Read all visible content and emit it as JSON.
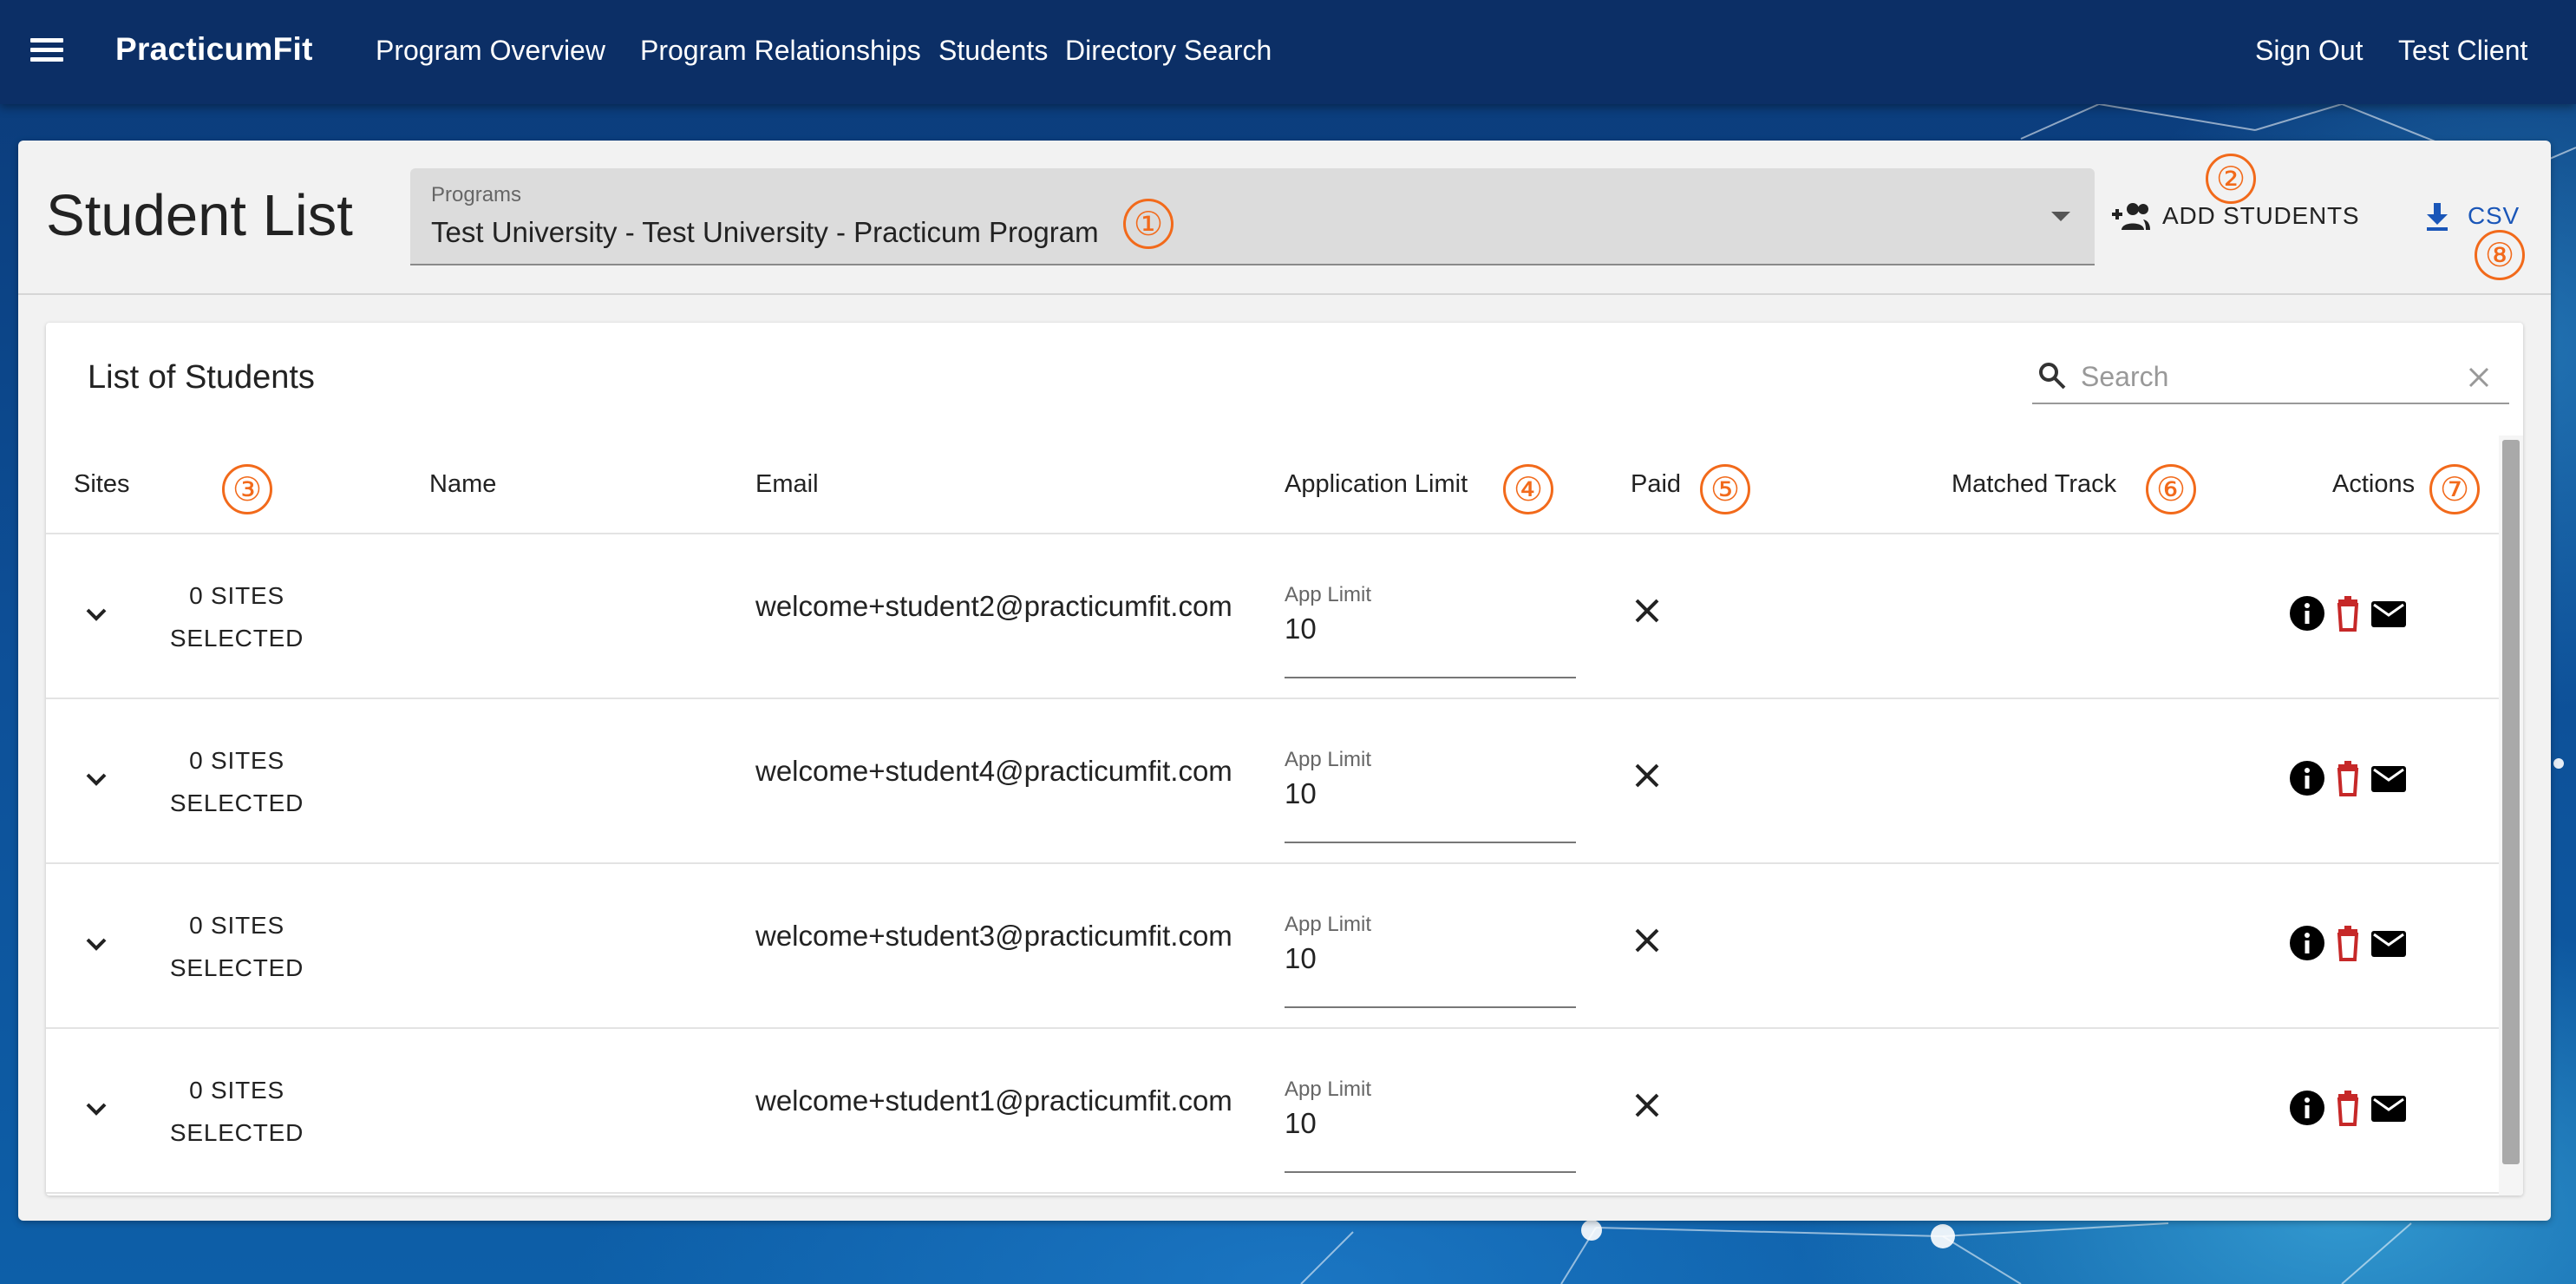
{
  "topbar": {
    "brand": "PracticumFit",
    "nav": [
      "Program Overview",
      "Program Relationships",
      "Students",
      "Directory Search"
    ],
    "sign_out": "Sign Out",
    "user": "Test Client"
  },
  "page": {
    "title": "Student List",
    "programs_label": "Programs",
    "programs_value": "Test University - Test University - Practicum Program",
    "add_students": "ADD STUDENTS",
    "csv": "CSV"
  },
  "list": {
    "title": "List of Students",
    "search_placeholder": "Search",
    "columns": [
      "Sites",
      "Name",
      "Email",
      "Application Limit",
      "Paid",
      "Matched Track",
      "Actions"
    ],
    "rows": [
      {
        "sites_line1": "0 SITES",
        "sites_line2": "SELECTED",
        "name": "",
        "email": "welcome+student2@practicumfit.com",
        "app_limit_label": "App Limit",
        "app_limit": "10",
        "matched_track": ""
      },
      {
        "sites_line1": "0 SITES",
        "sites_line2": "SELECTED",
        "name": "",
        "email": "welcome+student4@practicumfit.com",
        "app_limit_label": "App Limit",
        "app_limit": "10",
        "matched_track": ""
      },
      {
        "sites_line1": "0 SITES",
        "sites_line2": "SELECTED",
        "name": "",
        "email": "welcome+student3@practicumfit.com",
        "app_limit_label": "App Limit",
        "app_limit": "10",
        "matched_track": ""
      },
      {
        "sites_line1": "0 SITES",
        "sites_line2": "SELECTED",
        "name": "",
        "email": "welcome+student1@practicumfit.com",
        "app_limit_label": "App Limit",
        "app_limit": "10",
        "matched_track": ""
      }
    ]
  },
  "markers": [
    "①",
    "②",
    "③",
    "④",
    "⑤",
    "⑥",
    "⑦",
    "⑧"
  ],
  "colors": {
    "topbar": "#0c2f66",
    "marker": "#f26a1b",
    "csv_blue": "#1a56b8",
    "delete_red": "#c62828"
  },
  "icons": {
    "menu": "hamburger-menu-icon",
    "add_students": "group-add-icon",
    "csv": "download-icon",
    "search": "search-icon",
    "clear": "close-icon",
    "expand": "chevron-down-icon",
    "paid_false": "close-icon",
    "info": "info-icon",
    "delete": "trash-icon",
    "email": "mail-icon"
  }
}
